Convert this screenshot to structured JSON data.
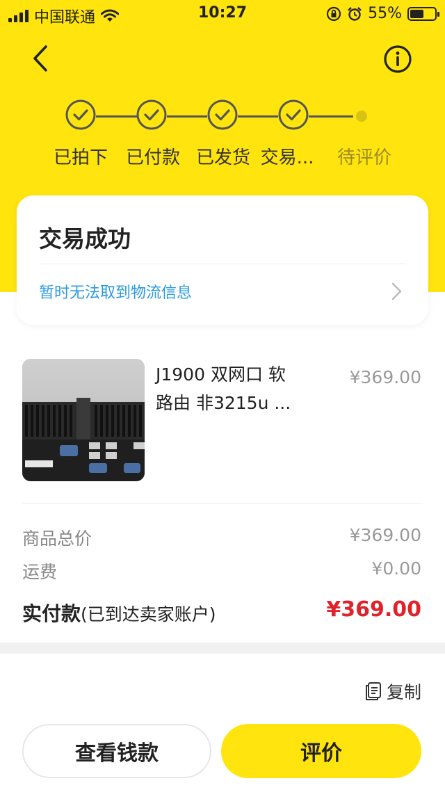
{
  "status_bar": {
    "carrier": "中国联通",
    "time": "10:27",
    "battery": "55%",
    "battery_level": 0.55
  },
  "header": {
    "back_icon": "chevron-left-icon",
    "info_icon": "info-icon"
  },
  "steps": [
    {
      "label": "已拍下",
      "done": true
    },
    {
      "label": "已付款",
      "done": true
    },
    {
      "label": "已发货",
      "done": true
    },
    {
      "label": "交易...",
      "done": true
    },
    {
      "label": "待评价",
      "done": false
    }
  ],
  "status_card": {
    "title": "交易成功",
    "logistics": "暂时无法取到物流信息"
  },
  "product": {
    "title_line1": "J1900 双网口 软",
    "title_line2": "路由 非3215u ...",
    "price": "¥369.00"
  },
  "summary": {
    "total_label": "商品总价",
    "total_value": "¥369.00",
    "shipping_label": "运费",
    "shipping_value": "¥0.00",
    "paid_label": "实付款",
    "paid_note": "(已到达卖家账户)",
    "paid_value": "¥369.00"
  },
  "order": {
    "copy_label": "复制"
  },
  "actions": {
    "view_money": "查看钱款",
    "review": "评价"
  },
  "colors": {
    "brand_yellow": "#ffe40d",
    "link_blue": "#2a9ae0",
    "price_red": "#e0232b"
  }
}
